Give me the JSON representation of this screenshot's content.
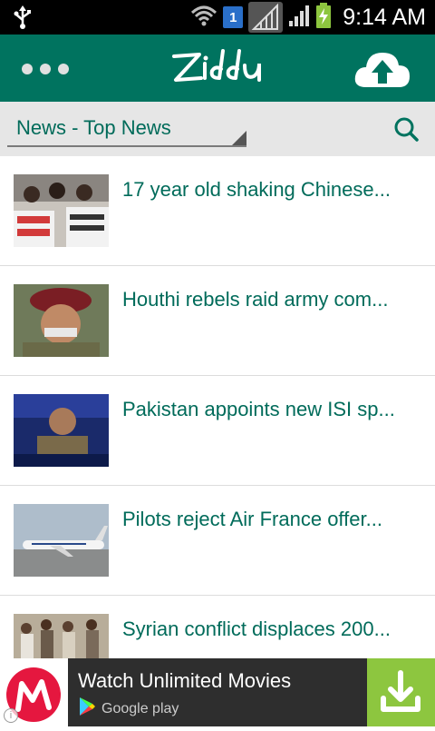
{
  "status_bar": {
    "time": "9:14 AM",
    "sim_number": "1",
    "icons": [
      "usb-icon",
      "wifi-icon",
      "sim-icon",
      "signal-icon",
      "battery-charging-icon"
    ]
  },
  "app_bar": {
    "logo_text": "Ziddu",
    "menu_icon": "more-dots-icon",
    "upload_icon": "cloud-upload-icon"
  },
  "filter": {
    "category_label": "News - Top News",
    "search_icon": "search-icon"
  },
  "news": [
    {
      "title": "17 year old shaking Chinese..."
    },
    {
      "title": "Houthi rebels raid army com..."
    },
    {
      "title": "Pakistan appoints new ISI sp..."
    },
    {
      "title": "Pilots reject Air France offer..."
    },
    {
      "title": "Syrian conflict displaces 200..."
    }
  ],
  "ad": {
    "title": "Watch Unlimited Movies",
    "store_label": "Google play",
    "brand_color": "#e5173f",
    "download_color": "#8dc63f"
  },
  "colors": {
    "app_bar": "#00735f",
    "accent_text": "#006b5a"
  }
}
